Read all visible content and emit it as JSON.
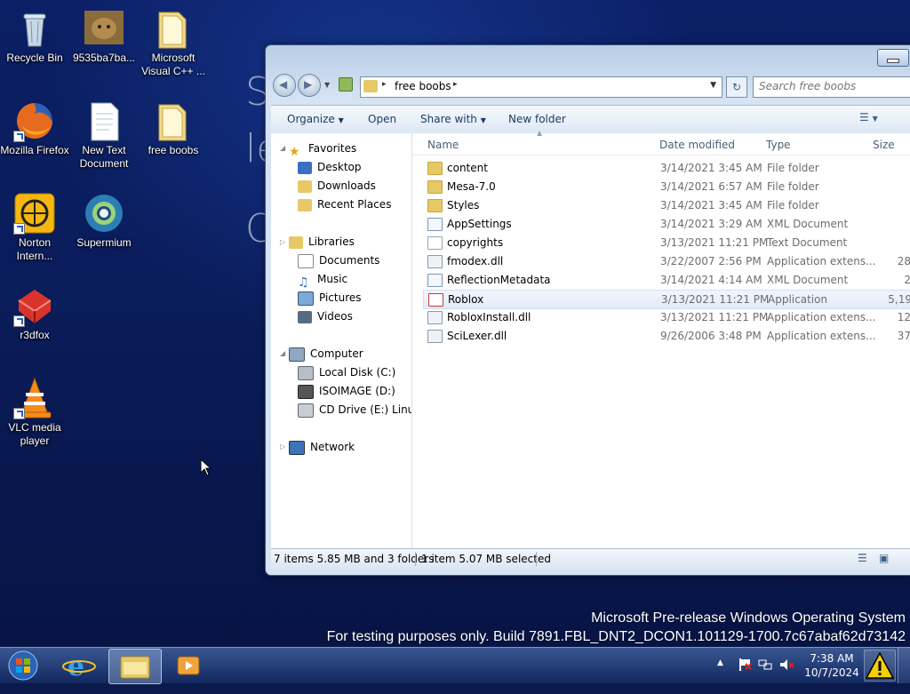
{
  "desktop": {
    "background_text": [
      "S",
      "le",
      "O"
    ],
    "icons": [
      {
        "label": "Recycle Bin",
        "icon": "recycle-bin-icon"
      },
      {
        "label": "9535ba7ba...",
        "icon": "image-file-icon"
      },
      {
        "label": "Microsoft Visual C++ ...",
        "icon": "folder-icon"
      },
      {
        "label": "Mozilla Firefox",
        "icon": "firefox-icon"
      },
      {
        "label": "New Text Document",
        "icon": "text-document-icon"
      },
      {
        "label": "free boobs",
        "icon": "folder-icon"
      },
      {
        "label": "Norton Intern...",
        "icon": "norton-icon"
      },
      {
        "label": "Supermium",
        "icon": "supermium-icon"
      },
      {
        "label": "r3dfox",
        "icon": "r3dfox-icon"
      },
      {
        "label": "VLC media player",
        "icon": "vlc-icon"
      }
    ],
    "watermark": {
      "line1": "Microsoft Pre-release Windows Operating System",
      "line2": "For testing purposes only. Build 7891.FBL_DNT2_DCON1.101129-1700.7c67abaf62d73142"
    }
  },
  "explorer": {
    "address": {
      "path": "free boobs",
      "separator": "▸"
    },
    "search": {
      "placeholder": "Search free boobs"
    },
    "toolbar": {
      "organize": "Organize",
      "open": "Open",
      "share_with": "Share with",
      "new_folder": "New folder"
    },
    "nav": {
      "favorites": "Favorites",
      "desktop": "Desktop",
      "downloads": "Downloads",
      "recent": "Recent Places",
      "libraries": "Libraries",
      "documents": "Documents",
      "music": "Music",
      "pictures": "Pictures",
      "videos": "Videos",
      "computer": "Computer",
      "local_disk": "Local Disk (C:)",
      "isoimage": "ISOIMAGE (D:)",
      "cd_drive": "CD Drive (E:) Linux M",
      "network": "Network"
    },
    "columns": {
      "name": "Name",
      "date": "Date modified",
      "type": "Type",
      "size": "Size"
    },
    "files": [
      {
        "name": "content",
        "date": "3/14/2021 3:45 AM",
        "type": "File folder",
        "size": "",
        "kind": "folder"
      },
      {
        "name": "Mesa-7.0",
        "date": "3/14/2021 6:57 AM",
        "type": "File folder",
        "size": "",
        "kind": "folder"
      },
      {
        "name": "Styles",
        "date": "3/14/2021 3:45 AM",
        "type": "File folder",
        "size": "",
        "kind": "folder"
      },
      {
        "name": "AppSettings",
        "date": "3/14/2021 3:29 AM",
        "type": "XML Document",
        "size": "",
        "kind": "xml"
      },
      {
        "name": "copyrights",
        "date": "3/13/2021 11:21 PM",
        "type": "Text Document",
        "size": "",
        "kind": "text"
      },
      {
        "name": "fmodex.dll",
        "date": "3/22/2007 2:56 PM",
        "type": "Application extens...",
        "size": "28",
        "kind": "dll"
      },
      {
        "name": "ReflectionMetadata",
        "date": "3/14/2021 4:14 AM",
        "type": "XML Document",
        "size": "2",
        "kind": "xml"
      },
      {
        "name": "Roblox",
        "date": "3/13/2021 11:21 PM",
        "type": "Application",
        "size": "5,19",
        "kind": "app",
        "selected": true
      },
      {
        "name": "RobloxInstall.dll",
        "date": "3/13/2021 11:21 PM",
        "type": "Application extens...",
        "size": "12",
        "kind": "dll"
      },
      {
        "name": "SciLexer.dll",
        "date": "9/26/2006 3:48 PM",
        "type": "Application extens...",
        "size": "37",
        "kind": "dll"
      }
    ],
    "status": {
      "items": "7 items 5.85 MB and 3 folders",
      "selected": "1 item 5.07 MB selected"
    }
  },
  "taskbar": {
    "items": [
      "start-orb",
      "internet-explorer",
      "windows-explorer",
      "media-player"
    ],
    "clock": {
      "time": "7:38 AM",
      "date": "10/7/2024"
    },
    "tray": [
      "show-hidden-icons",
      "action-center-flag",
      "network",
      "volume-muted",
      "warning"
    ]
  },
  "colors": {
    "accent": "#3b6fb6",
    "selection": "#e1ebf8",
    "folder": "#e7c867"
  }
}
